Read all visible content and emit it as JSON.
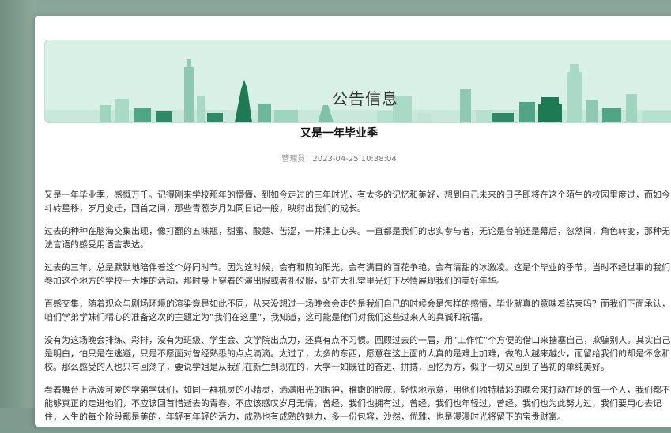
{
  "banner": {
    "title": "公告信息"
  },
  "article": {
    "title": "又是一年毕业季",
    "author": "管理员",
    "date": "2023-04-25 10:38:04",
    "paragraphs": [
      "又是一年毕业季，感慨万千。记得刚来学校那年的懵懂，到如今走过的三年时光，有太多的记忆和美好，想到自己未来的日子即将在这个陌生的校园里度过，而如今斗转星移，岁月变迁，回首之间，那些青葱岁月如同日记一般，映射出我们的成长。",
      "过去的种种在脑海交集出现，像打翻的五味瓶，甜蜜、酸楚、苦涩，一并涌上心头。一直都是我们的忠实参与者，无论是台前还是幕后，忽然间，角色转变，那种无法言语的感受用语言表达。",
      "过去的三年，总是默默地陪伴着这个好同时节。因为这时候，会有和煦的阳光，会有满目的百花争艳，会有清甜的冰激凌。这是个毕业的季节，当时不经世事的我们参加这个地方的学校一大堆的活动，那时身上穿着的演出服或者礼仪服，站在大礼堂里光灯下尽情展现我们的美好年华。",
      "百感交集，随着观众与剧场环境的渲染竟是如此不同，从来没想过一场晚会会走的是我们自己的时候会是怎样的感情，毕业就真的意味着结束吗？而我们下面承认，咱们学弟学妹们精心的准备这次的主题定为“我们在这里”，我知道，这可能是他们对我们这些过来人的真诚和祝福。",
      "没有为这场晚会排练、彩排，没有为班级、学生会、文学院出点力，还真有点不习惯。回顾过去的一届，用“工作忙”个方便的借口来搪塞自己，欺骗别人。其实自己是明白，怕只是在逃避，只是不愿面对曾经熟悉的点点滴滴。太过了，太多的东西，愿意在这上面的人真的是难上加难，做的人越来越少，而留给我们的却是怀念和校。那么感受的人也只有回荡了，要说学姐是从我们在新生到现在的，大学一如既往的奋进、拼搏，回忆为方，似乎一切又回到了当初的单纯美好。",
      "看着舞台上活泼可爱的学弟学妹们，如同一群机灵的小精灵，洒满阳光的眼神，稚嫩的脸庞，轻快地示意，用他们独特精彩的晚会来打动在场的每一个人，我们都不能够真正的走进他们，不应该回首惜逝去的青春，不应该感叹岁月无情，曾经，我们也拥有过，曾经，我们也年轻过，曾经，我们也为此努力过，我们要用心去记住，人生的每个阶段都是美的，年轻有年轻的活力，成熟也有成熟的魅力，多一份包容，沙然，优雅，也是漫漫时光将留下的宝贵财富。"
    ]
  }
}
